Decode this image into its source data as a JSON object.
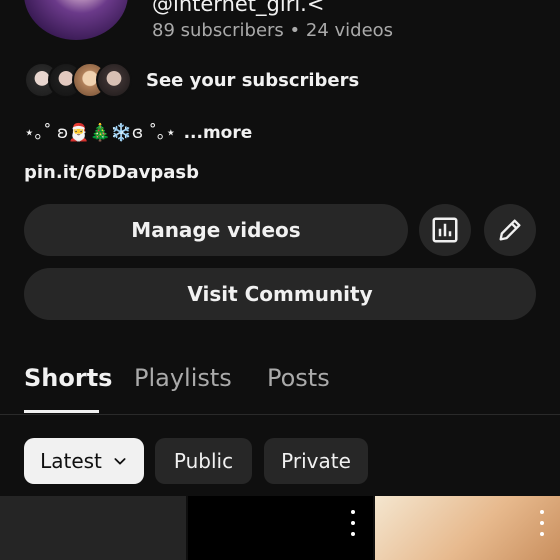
{
  "channel": {
    "handle": "@internet_girl.<",
    "subscribers": "89 subscribers",
    "separator": "•",
    "videos": "24 videos",
    "see_subscribers": "See your subscribers",
    "bio": "⋆｡˚ ʚ🎅🎄❄️ɞ ˚｡⋆",
    "more": "...more",
    "link": "pin.it/6DDavpasb"
  },
  "actions": {
    "manage_videos": "Manage videos",
    "analytics_icon": "bar-chart-icon",
    "edit_icon": "pencil-icon",
    "visit_community": "Visit Community"
  },
  "tabs": [
    {
      "label": "Shorts",
      "active": true
    },
    {
      "label": "Playlists",
      "active": false
    },
    {
      "label": "Posts",
      "active": false
    }
  ],
  "filters": {
    "latest": "Latest",
    "public": "Public",
    "private": "Private"
  },
  "colors": {
    "background": "#0f0f0f",
    "surface": "#272727",
    "text": "#f1f1f1",
    "muted": "#aaaaaa"
  }
}
